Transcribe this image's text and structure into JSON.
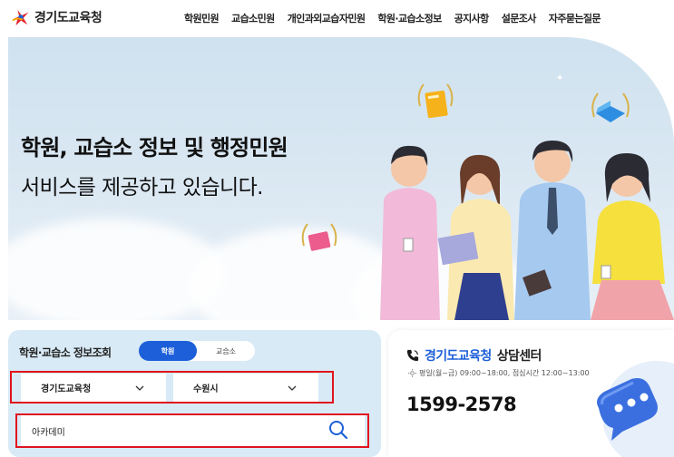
{
  "header": {
    "logo_text": "경기도교육청",
    "nav": [
      "학원민원",
      "교습소민원",
      "개인과외교습자민원",
      "학원·교습소정보",
      "공지사항",
      "설문조사",
      "자주묻는질문"
    ]
  },
  "hero": {
    "title": "학원, 교습소 정보 및 행정민원",
    "subtitle": "서비스를 제공하고 있습니다."
  },
  "search": {
    "heading": "학원·교습소 정보조회",
    "tabs": [
      "학원",
      "교습소"
    ],
    "active_tab": "학원",
    "select_office": "경기도교육청",
    "select_city": "수원시",
    "query_value": "아카데미"
  },
  "center": {
    "brand": "경기도교육청",
    "title_suffix": "상담센터",
    "hours": "평일(월~금) 09:00~18:00, 점심시간 12:00~13:00",
    "phone": "1599-2578"
  },
  "colors": {
    "accent": "#1d5fd8",
    "highlight_box": "#e0141e",
    "hero_bg": "#d9e7f2",
    "search_card_bg": "#d8eaf6"
  },
  "icons": [
    "logo-star-icon",
    "chevron-down-icon",
    "search-icon",
    "phone-icon",
    "sun-icon",
    "chat-bubble-icon"
  ]
}
